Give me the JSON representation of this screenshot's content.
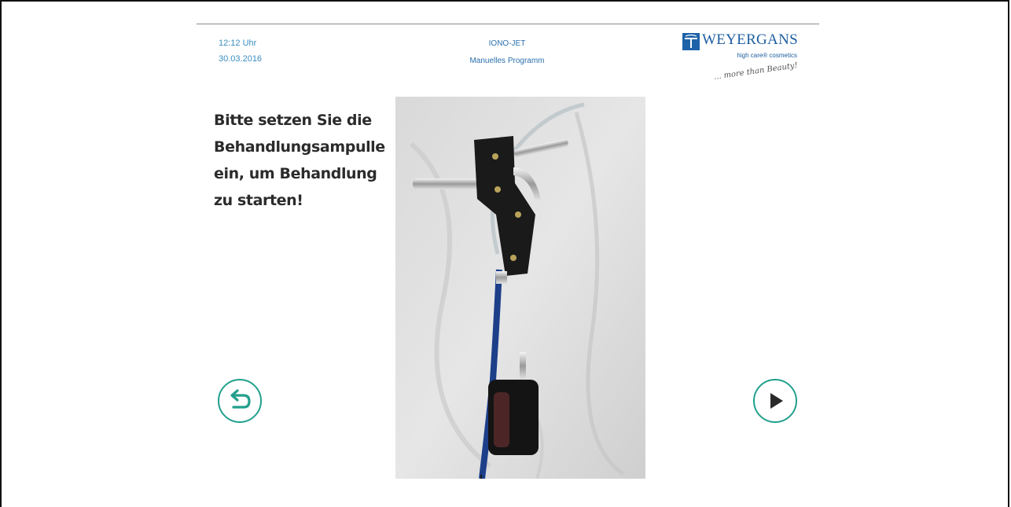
{
  "header": {
    "time": "12:12 Uhr",
    "date": "30.03.2016",
    "device": "IONO-JET",
    "program": "Manuelles Programm"
  },
  "logo": {
    "name": "WEYERGANS",
    "subtitle": "high care® cosmetics",
    "tagline": "... more than Beauty!"
  },
  "instruction": {
    "lines": [
      "Bitte setzen Sie die",
      "Behandlungsampulle",
      "ein, um Behandlung",
      "zu starten!"
    ]
  },
  "buttons": {
    "back_icon": "undo-arrow-icon",
    "play_icon": "play-icon"
  },
  "colors": {
    "accent": "#22a08d",
    "brand": "#1e5fa0",
    "header_text": "#3a8ec0"
  }
}
